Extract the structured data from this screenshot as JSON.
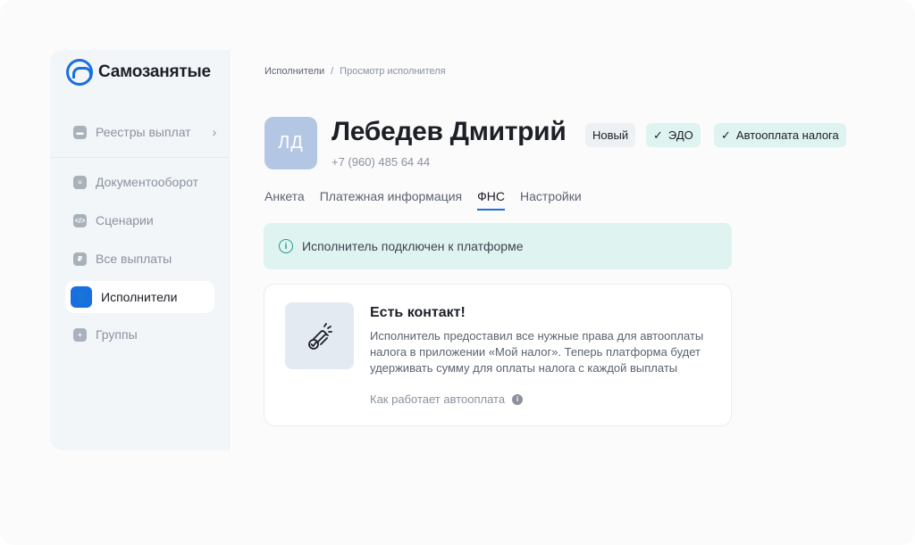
{
  "app": {
    "name": "Самозанятые"
  },
  "sidebar": {
    "items": [
      {
        "label": "Реестры выплат",
        "icon": "wallet-icon"
      },
      {
        "label": "Документооборот",
        "icon": "document-icon"
      },
      {
        "label": "Сценарии",
        "icon": "code-icon"
      },
      {
        "label": "Все выплаты",
        "icon": "ruble-icon"
      },
      {
        "label": "Исполнители",
        "icon": "users-icon",
        "active": true
      },
      {
        "label": "Группы",
        "icon": "add-group-icon"
      }
    ]
  },
  "breadcrumb": {
    "first": "Исполнители",
    "separator": "/",
    "current": "Просмотр исполнителя"
  },
  "profile": {
    "initials": "ЛД",
    "name": "Лебедев Дмитрий",
    "phone": "+7 (960) 485 64 44",
    "badges": {
      "new": "Новый",
      "edo": "ЭДО",
      "auto": "Автооплата налога"
    }
  },
  "tabs": [
    "Анкета",
    "Платежная информация",
    "ФНС",
    "Настройки"
  ],
  "active_tab": "ФНС",
  "alert": {
    "text": "Исполнитель подключен к платформе"
  },
  "card": {
    "title": "Есть контакт!",
    "text": "Исполнитель предоставил все нужные права для автооплаты налога в приложении «Мой налог». Теперь платформа будет удерживать сумму для оплаты налога с каждой выплаты",
    "link": "Как работает автооплата"
  },
  "colors": {
    "accent": "#1a6fe0",
    "success_bg": "#dff3f1",
    "success": "#1e9c8a"
  }
}
